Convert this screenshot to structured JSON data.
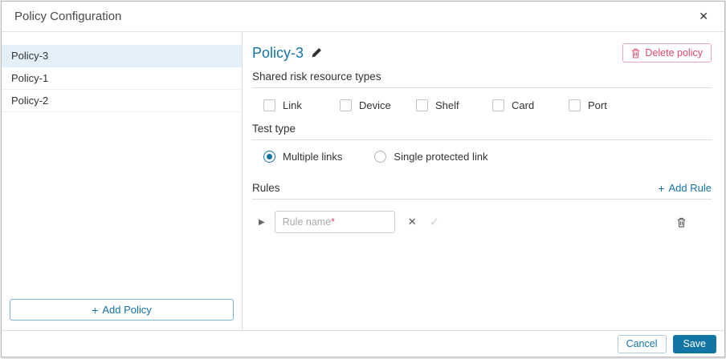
{
  "header": {
    "title": "Policy Configuration"
  },
  "icons": {
    "close": "✕",
    "plus": "+",
    "expand": "▶",
    "clear": "✕",
    "check": "✓"
  },
  "sidebar": {
    "items": [
      {
        "label": "Policy-3",
        "selected": true
      },
      {
        "label": "Policy-1",
        "selected": false
      },
      {
        "label": "Policy-2",
        "selected": false
      }
    ],
    "add_policy_label": "Add Policy"
  },
  "main": {
    "policy_title": "Policy-3",
    "delete_policy_label": "Delete policy",
    "shared_risk": {
      "label": "Shared risk resource types",
      "items": [
        "Link",
        "Device",
        "Shelf",
        "Card",
        "Port"
      ],
      "checked": [
        false,
        false,
        false,
        false,
        false
      ]
    },
    "test_type": {
      "label": "Test type",
      "options": [
        {
          "label": "Multiple links",
          "selected": true
        },
        {
          "label": "Single protected link",
          "selected": false
        }
      ]
    },
    "rules": {
      "label": "Rules",
      "add_rule_label": "Add Rule",
      "rule_placeholder": "Rule name",
      "required_marker": "*",
      "rule_value": ""
    }
  },
  "footer": {
    "cancel_label": "Cancel",
    "save_label": "Save"
  },
  "colors": {
    "accent": "#1374a6",
    "danger": "#e2486b",
    "selected_bg": "#e3f0fa"
  }
}
